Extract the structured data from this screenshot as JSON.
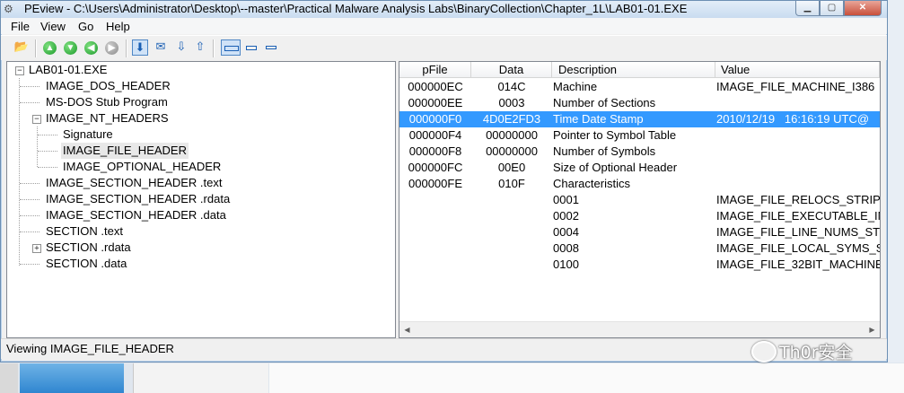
{
  "window": {
    "title": "PEview - C:\\Users\\Administrator\\Desktop\\--master\\Practical Malware Analysis Labs\\BinaryCollection\\Chapter_1L\\LAB01-01.EXE",
    "controls": {
      "minimize": "▁",
      "maximize": "▢",
      "close": "✕"
    }
  },
  "menu": [
    "File",
    "View",
    "Go",
    "Help"
  ],
  "toolbar": {
    "icons": [
      "open-icon",
      "up-icon",
      "down-icon",
      "back-icon",
      "forward-icon",
      "view-raw-icon",
      "view-hex-icon",
      "view-down-icon",
      "view-up-icon",
      "width-wide-icon",
      "width-medium-icon",
      "width-narrow-icon"
    ]
  },
  "tree": [
    {
      "label": "LAB01-01.EXE",
      "level": 0,
      "expander": "−"
    },
    {
      "label": "IMAGE_DOS_HEADER",
      "level": 1
    },
    {
      "label": "MS-DOS Stub Program",
      "level": 1
    },
    {
      "label": "IMAGE_NT_HEADERS",
      "level": 1,
      "expander": "−"
    },
    {
      "label": "Signature",
      "level": 2
    },
    {
      "label": "IMAGE_FILE_HEADER",
      "level": 2,
      "selected": true
    },
    {
      "label": "IMAGE_OPTIONAL_HEADER",
      "level": 2
    },
    {
      "label": "IMAGE_SECTION_HEADER .text",
      "level": 1
    },
    {
      "label": "IMAGE_SECTION_HEADER .rdata",
      "level": 1
    },
    {
      "label": "IMAGE_SECTION_HEADER .data",
      "level": 1
    },
    {
      "label": "SECTION .text",
      "level": 1
    },
    {
      "label": "SECTION .rdata",
      "level": 1,
      "expander": "+"
    },
    {
      "label": "SECTION .data",
      "level": 1
    }
  ],
  "table": {
    "columns": [
      "pFile",
      "Data",
      "Description",
      "Value"
    ],
    "rows": [
      {
        "pFile": "000000EC",
        "data": "014C",
        "description": "Machine",
        "value": "IMAGE_FILE_MACHINE_I386"
      },
      {
        "pFile": "000000EE",
        "data": "0003",
        "description": "Number of Sections",
        "value": ""
      },
      {
        "pFile": "000000F0",
        "data": "4D0E2FD3",
        "description": "Time Date Stamp",
        "value": "2010/12/19   16:16:19 UTC@",
        "selected": true
      },
      {
        "pFile": "000000F4",
        "data": "00000000",
        "description": "Pointer to Symbol Table",
        "value": ""
      },
      {
        "pFile": "000000F8",
        "data": "00000000",
        "description": "Number of Symbols",
        "value": ""
      },
      {
        "pFile": "000000FC",
        "data": "00E0",
        "description": "Size of Optional Header",
        "value": ""
      },
      {
        "pFile": "000000FE",
        "data": "010F",
        "description": "Characteristics",
        "value": ""
      },
      {
        "pFile": "",
        "data": "",
        "description": "0001",
        "value": "IMAGE_FILE_RELOCS_STRIPPED"
      },
      {
        "pFile": "",
        "data": "",
        "description": "0002",
        "value": "IMAGE_FILE_EXECUTABLE_IMAGE"
      },
      {
        "pFile": "",
        "data": "",
        "description": "0004",
        "value": "IMAGE_FILE_LINE_NUMS_STRIPPED"
      },
      {
        "pFile": "",
        "data": "",
        "description": "0008",
        "value": "IMAGE_FILE_LOCAL_SYMS_STRIPPED"
      },
      {
        "pFile": "",
        "data": "",
        "description": "0100",
        "value": "IMAGE_FILE_32BIT_MACHINE"
      }
    ]
  },
  "status": "Viewing IMAGE_FILE_HEADER",
  "watermark": "Th0r安全",
  "colors": {
    "selection": "#3399ff",
    "title_bar": "#c9dcf0"
  }
}
